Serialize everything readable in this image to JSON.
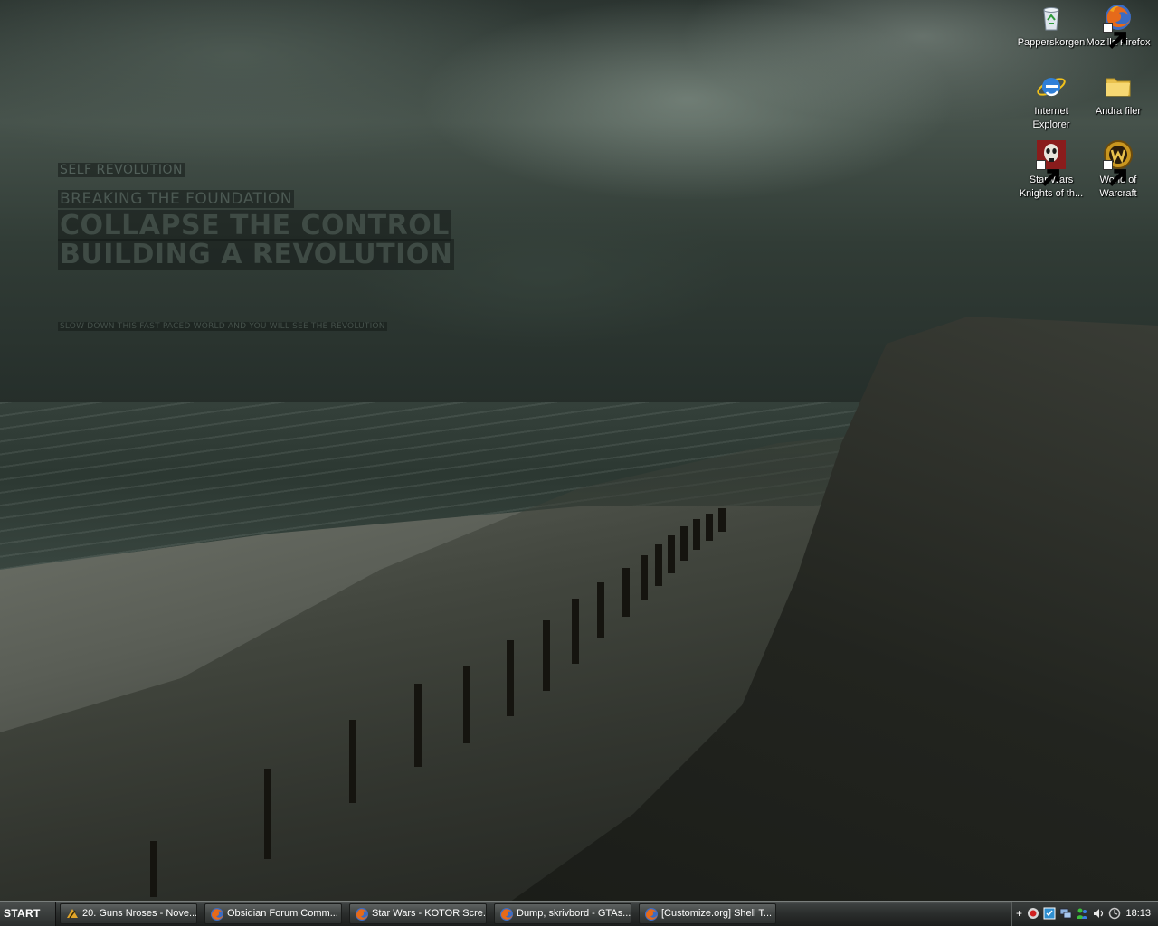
{
  "wallpaper": {
    "tagline": "SELF REVOLUTION",
    "subtitle": "BREAKING THE FOUNDATION",
    "headline_1": "COLLAPSE THE CONTROL",
    "headline_2": "BUILDING A REVOLUTION",
    "footer": "SLOW DOWN THIS FAST PACED WORLD AND YOU WILL SEE THE REVOLUTION"
  },
  "desktop_icons": [
    {
      "label": "Papperskorgen",
      "icon": "recycle-bin-icon"
    },
    {
      "label": "Mozilla Firefox",
      "icon": "firefox-icon"
    },
    {
      "label": "Internet Explorer",
      "icon": "internet-explorer-icon"
    },
    {
      "label": "Andra filer",
      "icon": "folder-icon"
    },
    {
      "label": "Star Wars Knights of th...",
      "icon": "kotor-icon"
    },
    {
      "label": "World of Warcraft",
      "icon": "wow-icon"
    }
  ],
  "taskbar": {
    "start_label": "START",
    "tasks": [
      {
        "label": "20. Guns Nroses - Nove...",
        "icon": "winamp-icon"
      },
      {
        "label": "Obsidian Forum Comm...",
        "icon": "firefox-icon"
      },
      {
        "label": "Star Wars - KOTOR Scre...",
        "icon": "firefox-icon"
      },
      {
        "label": "Dump, skrivbord - GTAs...",
        "icon": "firefox-icon"
      },
      {
        "label": "[Customize.org] Shell T...",
        "icon": "firefox-icon"
      }
    ],
    "tray": {
      "expand_label": "+",
      "icons": [
        "record-icon",
        "shield-icon",
        "network-icon",
        "msn-icon",
        "volume-icon",
        "sync-icon"
      ],
      "clock": "18:13"
    }
  },
  "colors": {
    "taskbar_bg": "#2a2d2c",
    "icon_text": "#ffffff",
    "wallpaper_text": "#3f4b45"
  }
}
